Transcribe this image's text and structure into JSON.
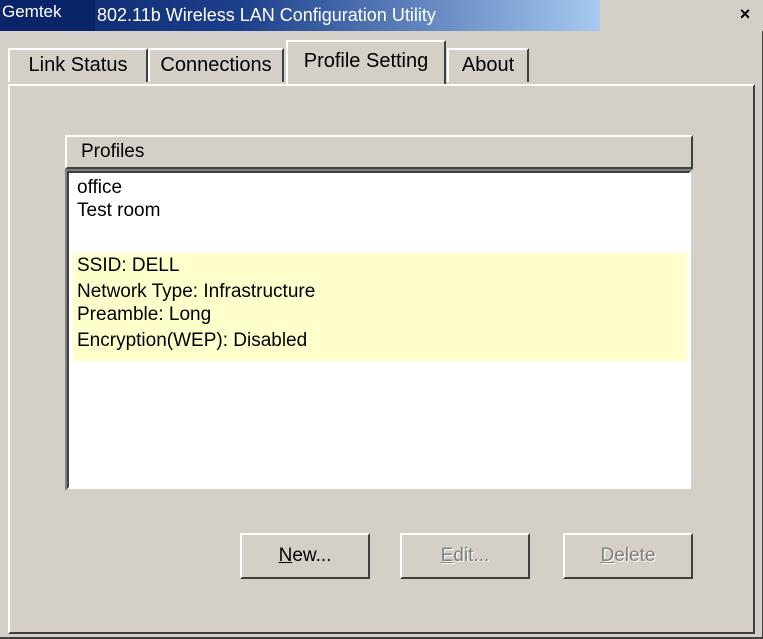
{
  "window": {
    "brand": "Gemtek",
    "title": "802.11b Wireless LAN Configuration Utility",
    "close_icon": "✕"
  },
  "tabs": [
    {
      "label": "Link Status"
    },
    {
      "label": "Connections"
    },
    {
      "label": "Profile Setting",
      "active": true
    },
    {
      "label": "About"
    }
  ],
  "profiles": {
    "header": "Profiles",
    "items": [
      "office",
      "Test room"
    ],
    "details": [
      "SSID: DELL",
      "Network Type: Infrastructure",
      "Preamble: Long",
      "Encryption(WEP): Disabled"
    ]
  },
  "buttons": {
    "new_label": "New...",
    "edit_label": "Edit...",
    "delete_label": "Delete"
  },
  "colors": {
    "title_bar": "#0a246a",
    "detail_highlight": "#ffffcc",
    "face": "#d4d0c8"
  }
}
